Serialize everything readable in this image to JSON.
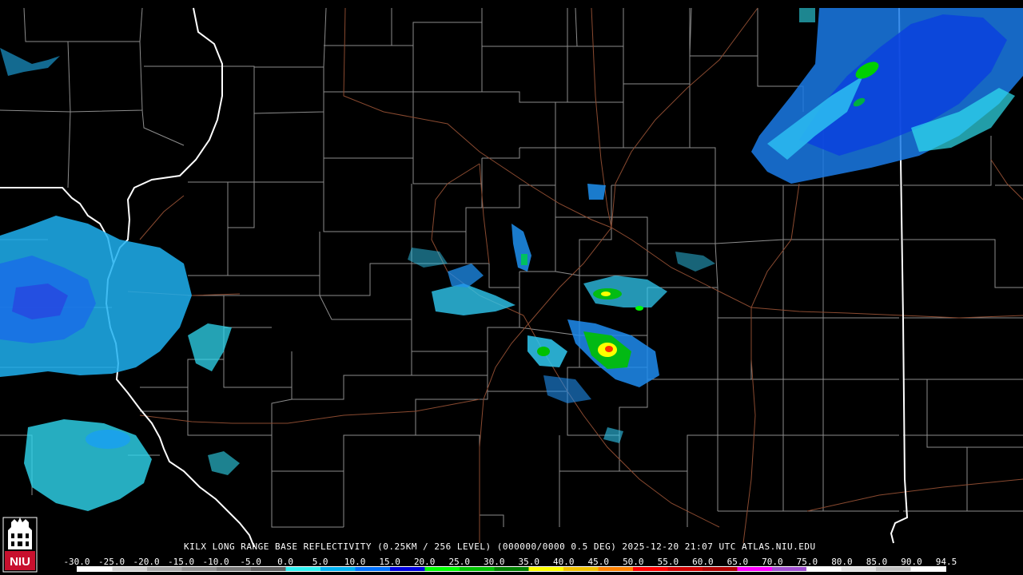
{
  "caption": "KILX LONG RANGE BASE REFLECTIVITY (0.25KM / 256 LEVEL) (000000/0000 0.5 DEG) 2025-12-20 21:07 UTC  ATLAS.NIU.EDU",
  "logo": {
    "text": "NIU",
    "icon": "niu-tower-logo-icon",
    "color": "#c8102e"
  },
  "scale": {
    "labels": [
      "-30.0",
      "-25.0",
      "-20.0",
      "-15.0",
      "-10.0",
      "-5.0",
      "0.0",
      "5.0",
      "10.0",
      "15.0",
      "20.0",
      "25.0",
      "30.0",
      "35.0",
      "40.0",
      "45.0",
      "50.0",
      "55.0",
      "60.0",
      "65.0",
      "70.0",
      "75.0",
      "80.0",
      "85.0",
      "90.0",
      "94.5"
    ],
    "colors": [
      "#ffffff",
      "#d0d0d0",
      "#a8a8a8",
      "#909090",
      "#787878",
      "#606060",
      "#30f0f0",
      "#00b0f0",
      "#0070ff",
      "#0000e0",
      "#00ff00",
      "#00c000",
      "#008000",
      "#ffff00",
      "#f0c000",
      "#ff8000",
      "#ff0000",
      "#d00000",
      "#b00000",
      "#ff00ff",
      "#a050d0",
      "#ffffff",
      "#e0e0e0",
      "#c0c0c0",
      "#ffffff"
    ]
  }
}
